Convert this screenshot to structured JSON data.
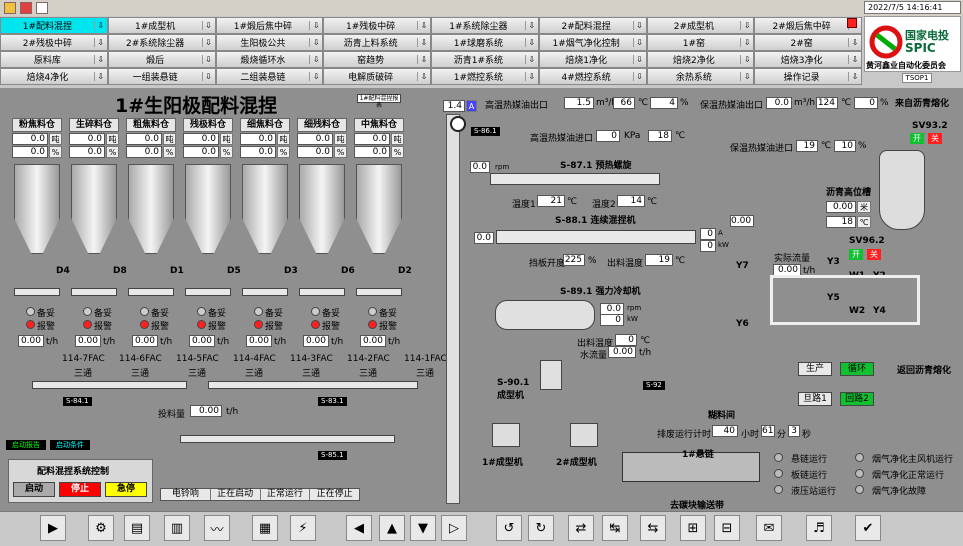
{
  "nav_rows": [
    [
      "1#配料混捏",
      "1#成型机",
      "1#煅后焦中碎",
      "1#残极中碎",
      "1#系统除尘器",
      "2#配料混捏",
      "2#成型机",
      "2#煅后焦中碎"
    ],
    [
      "2#残极中碎",
      "2#系统除尘器",
      "生阳极公共",
      "沥青上料系统",
      "1#球磨系统",
      "1#烟气净化控制",
      "1#窑",
      "2#窑"
    ],
    [
      "原料库",
      "煅后",
      "煅烧循环水",
      "窑趋势",
      "沥青1#系统",
      "焙烧1净化",
      "焙烧2净化",
      "焙烧3净化"
    ],
    [
      "焙烧4净化",
      "一组装悬链",
      "二组装悬链",
      "电解质破碎",
      "1#燃控系统",
      "4#燃控系统",
      "余热系统",
      "操作记录"
    ]
  ],
  "datetime": "2022/7/5 14:16:41",
  "logo_cn": "国家电投",
  "logo_en": "SPIC",
  "company": "黄河鑫业自动化委员会",
  "user_id": "TSOP1",
  "title": "1#生阳极配料混捏",
  "small_btn": "1#配料混捏报表",
  "bins": [
    {
      "name": "粉焦料仓",
      "v1": "0.0",
      "u1": "吨",
      "v2": "0.0",
      "u2": "%",
      "d": "D4",
      "fac": "114-7FAC",
      "tong": "三通"
    },
    {
      "name": "生碎料仓",
      "v1": "0.0",
      "u1": "吨",
      "v2": "0.0",
      "u2": "%",
      "d": "D8",
      "fac": "114-6FAC",
      "tong": "三通"
    },
    {
      "name": "粗焦料仓",
      "v1": "0.0",
      "u1": "吨",
      "v2": "0.0",
      "u2": "%",
      "d": "D1",
      "fac": "114-5FAC",
      "tong": "三通"
    },
    {
      "name": "残极料仓",
      "v1": "0.0",
      "u1": "吨",
      "v2": "0.0",
      "u2": "%",
      "d": "D5",
      "fac": "114-4FAC",
      "tong": "三通"
    },
    {
      "name": "细焦料仓",
      "v1": "0.0",
      "u1": "吨",
      "v2": "0.0",
      "u2": "%",
      "d": "D3",
      "fac": "114-3FAC",
      "tong": "三通"
    },
    {
      "name": "细残料仓",
      "v1": "0.0",
      "u1": "吨",
      "v2": "0.0",
      "u2": "%",
      "d": "D6",
      "fac": "114-2FAC",
      "tong": "三通"
    },
    {
      "name": "中焦料仓",
      "v1": "0.0",
      "u1": "吨",
      "v2": "0.0",
      "u2": "%",
      "d": "D2",
      "fac": "114-1FAC",
      "tong": "三通"
    }
  ],
  "status_ready": "备妥",
  "status_alarm": "报警",
  "flow_val": "0.00",
  "flow_unit": "t/h",
  "s841": "S-84.1",
  "s831": "S-83.1",
  "s851": "S-85.1",
  "s861": "S-86.1",
  "s92": "S-92",
  "feed_label": "投料量",
  "feed_val": "0.00",
  "feed_unit": "t/h",
  "btn_start_report": "启动报告",
  "btn_start_cond": "启动条件",
  "ctrl_title": "配料混捏系统控制",
  "btn_start": "启动",
  "btn_stop": "停止",
  "btn_estop": "急停",
  "status_bar": [
    "电铃响",
    "正在启动",
    "正常运行",
    "正在停止"
  ],
  "speed": "1.4",
  "speed_unit": "A",
  "oil_in": {
    "label": "高温热媒油出口",
    "v1": "1.5",
    "u1": "m³/h",
    "v2": "66",
    "u2": "℃",
    "v3": "4",
    "u3": "%"
  },
  "oil_out": {
    "label": "高温热媒油进口",
    "v1": "0",
    "u1": "KPa",
    "v2": "18",
    "u2": "℃"
  },
  "keep_out": {
    "label": "保温热媒油出口",
    "v1": "0.0",
    "u1": "m³/h",
    "v2": "124",
    "u2": "℃",
    "v3": "0",
    "u3": "%"
  },
  "keep_in": {
    "label": "保温热媒油进口",
    "v1": "19",
    "u1": "℃",
    "v2": "10",
    "u2": "%"
  },
  "from_pitch": "来自沥青熔化",
  "to_pitch": "返回沥青熔化",
  "s871": {
    "label": "S-87.1 预热螺旋",
    "rpm": "0.0",
    "rpm_unit": "rpm",
    "t1_label": "温度1",
    "t1": "21",
    "t2_label": "温度2",
    "t2": "14",
    "tu": "℃"
  },
  "s881": {
    "label": "S-88.1 连续混捏机",
    "rpm": "0.0",
    "a": "0",
    "a_unit": "A",
    "kw": "0",
    "kw_unit": "kW",
    "gate_label": "挡板开度",
    "gate": "225",
    "gate_unit": "%",
    "out_label": "出料温度",
    "out": "19",
    "out_unit": "℃",
    "top": "0.00"
  },
  "s891": {
    "label": "S-89.1 强力冷却机",
    "rpm": "0.0",
    "rpm_unit": "rpm",
    "kw": "0",
    "kw_unit": "kW",
    "t_label": "出料温度",
    "t": "0",
    "t_unit": "℃",
    "w_label": "水流量",
    "w": "0.00",
    "w_unit": "t/h"
  },
  "s901": {
    "label": "S-90.1 成型机"
  },
  "pitch_tank": {
    "label": "沥青高位槽",
    "v1": "0.00",
    "u1": "米",
    "v2": "18",
    "u2": "℃"
  },
  "sv932": {
    "label": "SV93.2",
    "on": "开",
    "off": "关"
  },
  "sv962": {
    "label": "SV96.2",
    "on": "开",
    "off": "关"
  },
  "flow": {
    "label": "实际流量",
    "val": "0.00",
    "unit": "t/h"
  },
  "valves": [
    "Y7",
    "Y3",
    "W1",
    "Y2",
    "Y5",
    "W2",
    "Y4",
    "Y6"
  ],
  "mode": {
    "prod": "生产",
    "cycle": "循环",
    "loop1": "旦路1",
    "loop2": "回路2"
  },
  "workshop": "糊料间",
  "sched": {
    "label": "排废运行计时",
    "h": "40",
    "hu": "小时",
    "m": "61",
    "mu": "分",
    "s": "3",
    "su": "秒"
  },
  "machine1": "1#成型机",
  "machine2": "2#成型机",
  "chain": "1#悬链",
  "conveyor": "去碳块输送带",
  "legend1": [
    "悬链运行",
    "板链运行",
    "液压站运行"
  ],
  "legend2": [
    "烟气净化主风机运行",
    "烟气净化正常运行",
    "烟气净化故障"
  ]
}
